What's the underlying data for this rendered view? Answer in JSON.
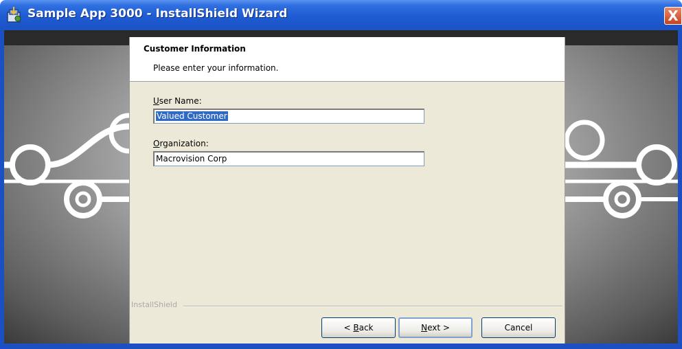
{
  "window": {
    "title": "Sample App 3000 - InstallShield Wizard",
    "close_label": "X",
    "icon": "installer-icon"
  },
  "header": {
    "title": "Customer Information",
    "subtitle": "Please enter your information."
  },
  "form": {
    "user_name": {
      "mnemonic": "U",
      "label_rest": "ser Name:",
      "value": "Valued Customer"
    },
    "organization": {
      "mnemonic": "O",
      "label_rest": "rganization:",
      "value": "Macrovision Corp"
    }
  },
  "footer": {
    "brand": "InstallShield"
  },
  "buttons": {
    "back": {
      "pre": "< ",
      "mnemonic": "B",
      "post": "ack"
    },
    "next": {
      "mnemonic": "N",
      "post": "ext >"
    },
    "cancel": {
      "label": "Cancel"
    }
  },
  "colors": {
    "titlebar": "#1f5bd2",
    "selection": "#316ac5",
    "dialog_bg": "#ece9d8",
    "close_button": "#c9401c"
  }
}
